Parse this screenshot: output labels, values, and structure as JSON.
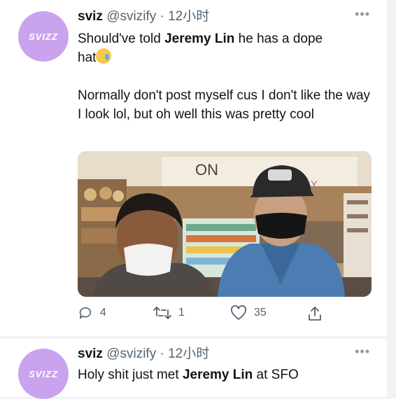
{
  "tweets": [
    {
      "avatar_text": "SVIZZ",
      "name": "sviz",
      "handle": "@svizify",
      "separator": "·",
      "time": "12小时",
      "more": "•••",
      "text_line1_before": "Should've told ",
      "text_line1_bold": "Jeremy Lin",
      "text_line1_after": " he has a dope",
      "text_line2": "hat",
      "paragraph2": "Normally don't post myself cus I don't like the way I look lol, but oh well this was pretty cool",
      "photo_sign": "ON",
      "photo_sign2": "FLY",
      "actions": {
        "replies": "4",
        "retweets": "1",
        "likes": "35"
      }
    },
    {
      "avatar_text": "SVIZZ",
      "name": "sviz",
      "handle": "@svizify",
      "separator": "·",
      "time": "12小时",
      "more": "•••",
      "text_before": "Holy shit just met ",
      "text_bold": "Jeremy Lin",
      "text_after": " at SFO"
    }
  ],
  "icons": [
    "reply-icon",
    "retweet-icon",
    "like-icon",
    "share-icon",
    "more-icon",
    "sleepy-face-emoji"
  ]
}
